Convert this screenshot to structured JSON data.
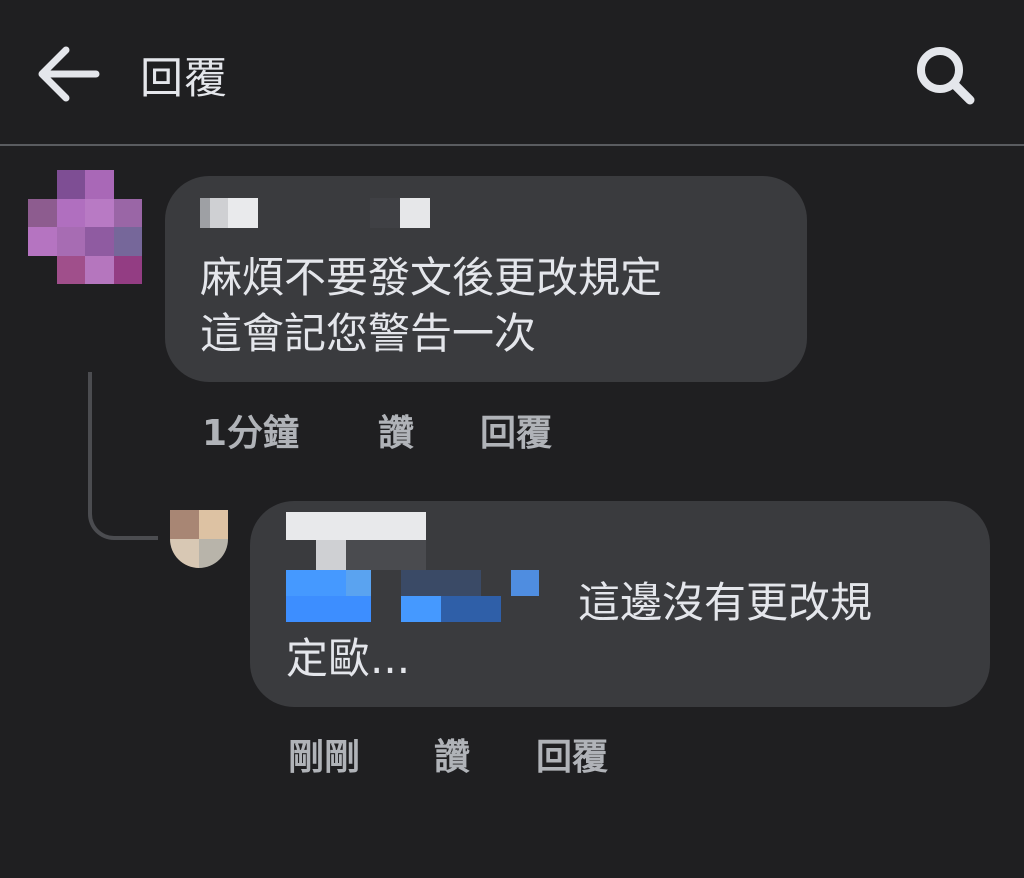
{
  "header": {
    "title": "回覆",
    "back_icon": "arrow-left-icon",
    "search_icon": "search-icon"
  },
  "comments": [
    {
      "text": "麻煩不要發文後更改規定\n這會記您警告一次",
      "time": "1分鐘",
      "like_label": "讚",
      "reply_label": "回覆"
    },
    {
      "text_line1": "這邊沒有更改規",
      "text_line2": "定歐...",
      "time": "剛剛",
      "like_label": "讚",
      "reply_label": "回覆"
    }
  ],
  "colors": {
    "background": "#1f1f21",
    "bubble": "#3a3b3e",
    "text": "#e4e6eb",
    "secondary_text": "#b0b3b8",
    "mention_blue": "#4599ff"
  }
}
